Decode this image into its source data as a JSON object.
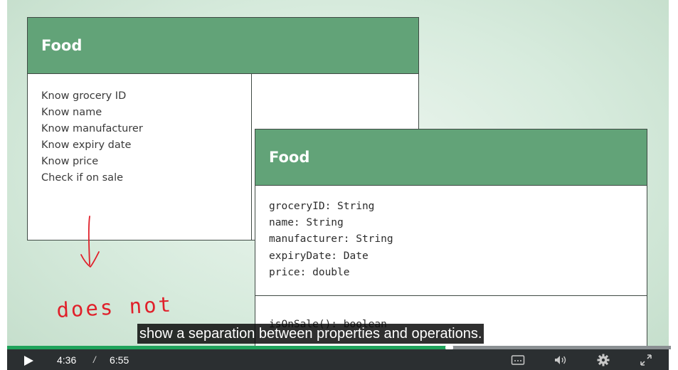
{
  "crc_card": {
    "title": "Food",
    "responsibilities": [
      "Know grocery ID",
      "Know name",
      "Know manufacturer",
      "Know expiry date",
      "Know price",
      "Check if on sale"
    ]
  },
  "uml_card": {
    "title": "Food",
    "attributes": [
      "groceryID: String",
      "name: String",
      "manufacturer: String",
      "expiryDate: Date",
      "price: double"
    ],
    "operations": [
      "isOnSale(): boolean"
    ]
  },
  "annotation": {
    "handwritten_text": "does not",
    "ink_color": "#e0202a"
  },
  "caption": {
    "text": "show a separation between properties and operations."
  },
  "player": {
    "current_time": "4:36",
    "time_separator": "/",
    "duration": "6:55",
    "progress_fraction": 0.666,
    "icons": [
      "play-icon",
      "captions-icon",
      "volume-icon",
      "settings-icon",
      "fullscreen-icon"
    ],
    "accent_color": "#1fa35b"
  },
  "colors": {
    "card_header": "#62a378",
    "background": "#d7ebdd"
  }
}
